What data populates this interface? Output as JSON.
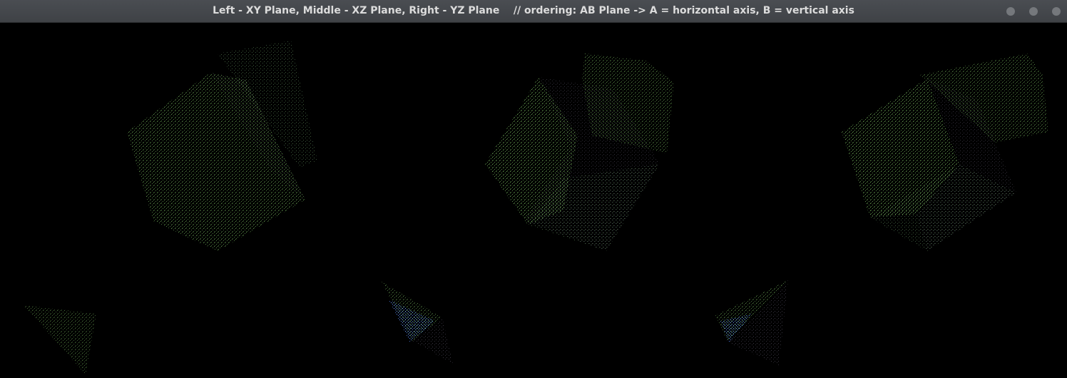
{
  "window": {
    "title": "Left - XY Plane, Middle - XZ Plane, Right - YZ Plane    // ordering: AB Plane -> A = horizontal axis, B = vertical axis",
    "controls": [
      "minimize-button",
      "maximize-button",
      "close-button"
    ]
  },
  "colors": {
    "background": "#000000",
    "titlebar": "#43464a",
    "title_text": "#dcdcdc",
    "control": "#75787c",
    "cube_green_bright": "#5d8f4c",
    "cube_green_dim": "#34472e",
    "cube_dark": "#2c2b33",
    "tetra_blue": "#5b88ff",
    "tetra_green": "#5f9a4a"
  }
}
